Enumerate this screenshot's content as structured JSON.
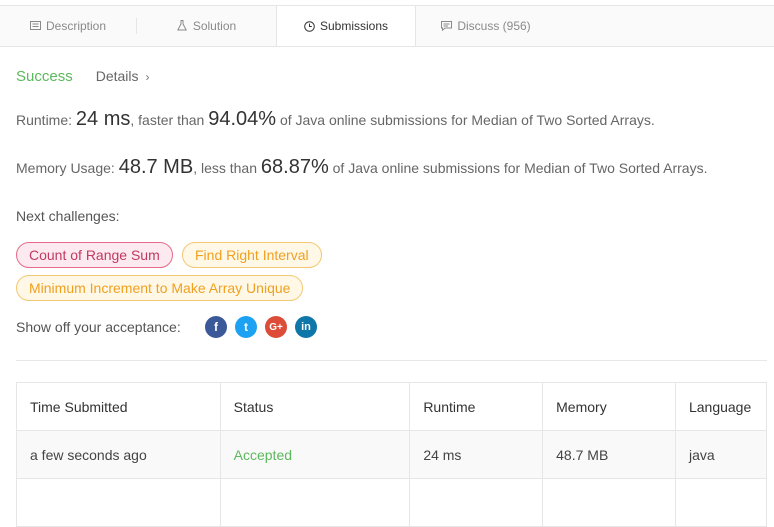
{
  "tabs": [
    {
      "label": "Description",
      "icon": "description-icon"
    },
    {
      "label": "Solution",
      "icon": "flask-icon"
    },
    {
      "label": "Submissions",
      "icon": "clock-icon",
      "active": true
    },
    {
      "label": "Discuss (956)",
      "icon": "chat-icon"
    }
  ],
  "result": {
    "status": "Success",
    "details_label": "Details",
    "details_chevron": "›"
  },
  "runtime": {
    "label": "Runtime:",
    "value": "24 ms",
    "comparison": ", faster than",
    "percent": "94.04%",
    "suffix": "of Java online submissions for Median of Two Sorted Arrays."
  },
  "memory": {
    "label": "Memory Usage:",
    "value": "48.7 MB",
    "comparison": ", less than",
    "percent": "68.87%",
    "suffix": "of Java online submissions for Median of Two Sorted Arrays."
  },
  "next": {
    "label": "Next challenges:",
    "challenges": [
      {
        "title": "Count of Range Sum",
        "difficulty": "hard"
      },
      {
        "title": "Find Right Interval",
        "difficulty": "medium"
      },
      {
        "title": "Minimum Increment to Make Array Unique",
        "difficulty": "medium"
      }
    ]
  },
  "share": {
    "label": "Show off your acceptance:",
    "networks": [
      {
        "name": "facebook",
        "glyph": "f",
        "color": "#3b5998"
      },
      {
        "name": "twitter",
        "glyph": "t",
        "color": "#1da1f2"
      },
      {
        "name": "google-plus",
        "glyph": "G+",
        "color": "#dd4b39"
      },
      {
        "name": "linkedin",
        "glyph": "in",
        "color": "#0e76a8"
      }
    ]
  },
  "table": {
    "headers": [
      "Time Submitted",
      "Status",
      "Runtime",
      "Memory",
      "Language"
    ],
    "rows": [
      [
        "a few seconds ago",
        "Accepted",
        "24 ms",
        "48.7 MB",
        "java"
      ]
    ]
  },
  "colors": {
    "success": "#5cb85c",
    "hard_text": "#c03a62",
    "medium_text": "#f0a020"
  }
}
